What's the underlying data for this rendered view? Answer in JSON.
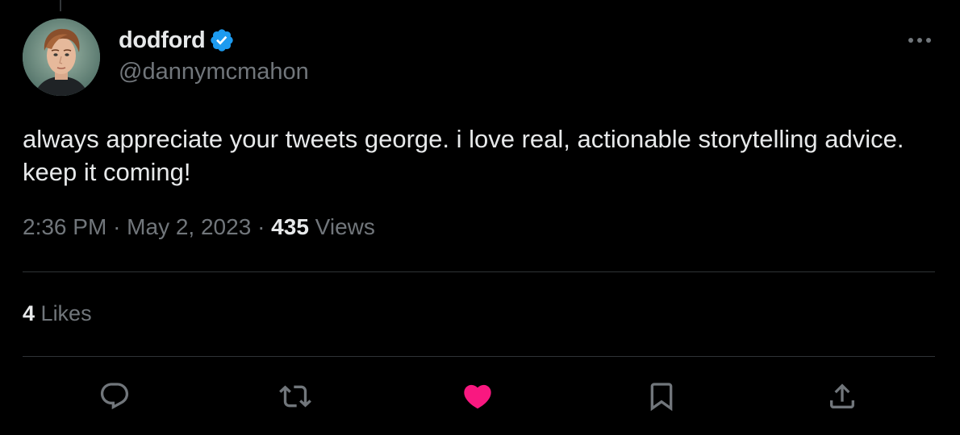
{
  "tweet": {
    "author": {
      "display_name": "dodford",
      "handle": "@dannymcmahon",
      "verified": true,
      "avatar": "profile-photo"
    },
    "text": "always appreciate your tweets george. i love real, actionable storytelling advice. keep it coming!",
    "time": "2:36 PM",
    "separator": "·",
    "date": "May 2, 2023",
    "views_count": "435",
    "views_label": "Views",
    "likes_count": "4",
    "likes_label": "Likes",
    "liked": true
  },
  "actions": [
    {
      "name": "reply",
      "icon": "reply-icon"
    },
    {
      "name": "retweet",
      "icon": "retweet-icon"
    },
    {
      "name": "like",
      "icon": "heart-icon",
      "active": true
    },
    {
      "name": "bookmark",
      "icon": "bookmark-icon"
    },
    {
      "name": "share",
      "icon": "share-icon"
    }
  ],
  "colors": {
    "background": "#000000",
    "primary_text": "#e7e9ea",
    "secondary_text": "#71767b",
    "divider": "#2f3336",
    "verified_blue": "#1d9bf0",
    "like_pink": "#f91880"
  }
}
